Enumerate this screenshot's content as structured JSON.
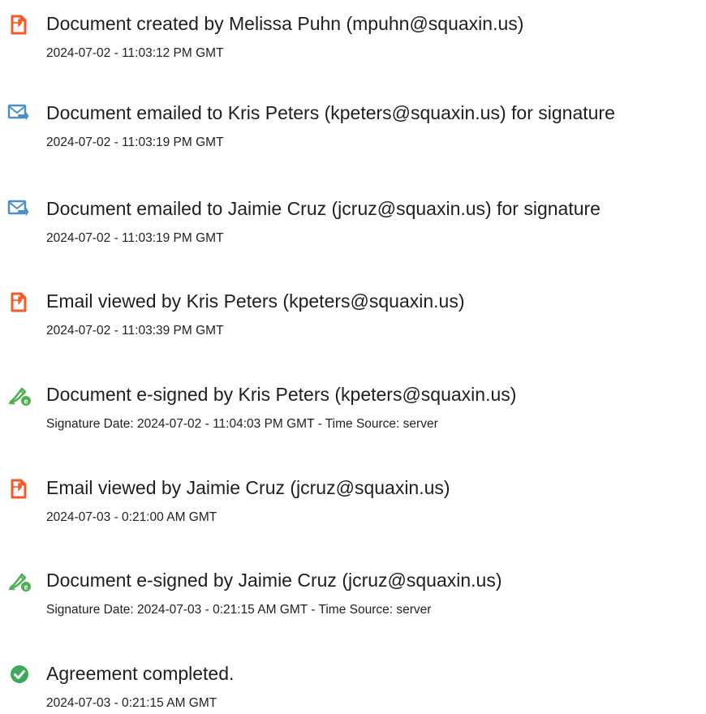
{
  "events": [
    {
      "icon": "document-created-icon",
      "title": "Document created by Melissa Puhn (mpuhn@squaxin.us)",
      "detail": "2024-07-02 - 11:03:12 PM GMT"
    },
    {
      "icon": "email-sent-icon",
      "title": "Document emailed to Kris Peters (kpeters@squaxin.us) for signature",
      "detail": "2024-07-02 - 11:03:19 PM GMT"
    },
    {
      "icon": "email-sent-icon",
      "title": "Document emailed to Jaimie Cruz (jcruz@squaxin.us) for signature",
      "detail": "2024-07-02 - 11:03:19 PM GMT"
    },
    {
      "icon": "document-viewed-icon",
      "title": "Email viewed by Kris Peters (kpeters@squaxin.us)",
      "detail": "2024-07-02 - 11:03:39 PM GMT"
    },
    {
      "icon": "esign-pen-icon",
      "title": "Document e-signed by Kris Peters (kpeters@squaxin.us)",
      "detail": "Signature Date: 2024-07-02 - 11:04:03 PM GMT - Time Source: server"
    },
    {
      "icon": "document-viewed-icon",
      "title": "Email viewed by Jaimie Cruz (jcruz@squaxin.us)",
      "detail": "2024-07-03 - 0:21:00 AM GMT"
    },
    {
      "icon": "esign-pen-icon",
      "title": "Document e-signed by Jaimie Cruz (jcruz@squaxin.us)",
      "detail": "Signature Date: 2024-07-03 - 0:21:15 AM GMT - Time Source: server"
    },
    {
      "icon": "checkmark-circle-icon",
      "title": "Agreement completed.",
      "detail": "2024-07-03 - 0:21:15 AM GMT"
    }
  ],
  "colors": {
    "document_icon": "#f15a29",
    "email_icon": "#4a90c8",
    "esign_icon": "#4caf50",
    "complete_icon": "#3aaa5c",
    "text": "#222222"
  }
}
